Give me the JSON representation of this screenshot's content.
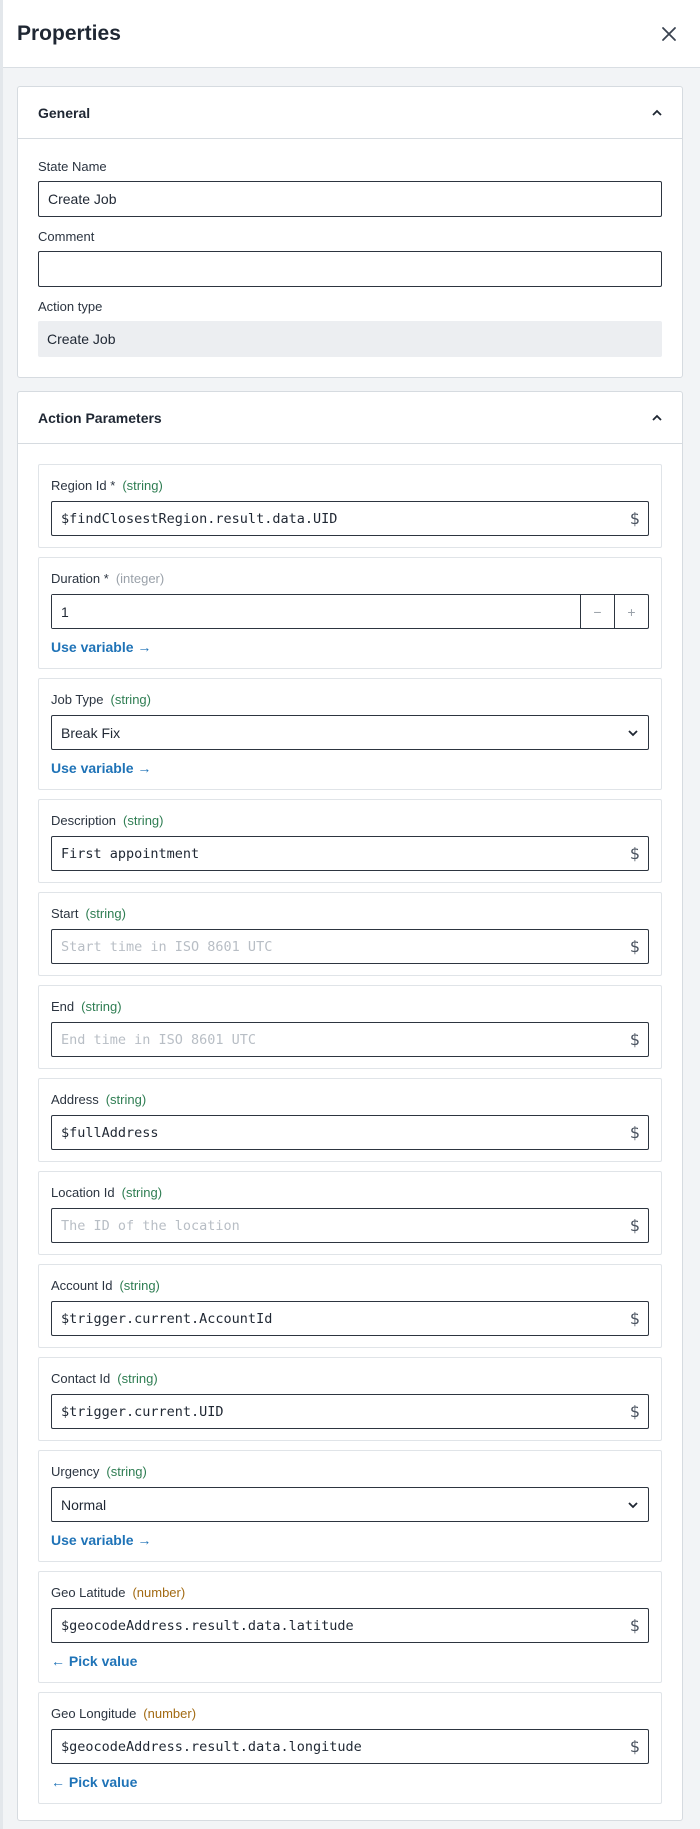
{
  "header": {
    "title": "Properties",
    "close_icon": "close-icon"
  },
  "general": {
    "title": "General",
    "state_name": {
      "label": "State Name",
      "value": "Create Job"
    },
    "comment": {
      "label": "Comment",
      "value": ""
    },
    "action_type": {
      "label": "Action type",
      "value": "Create Job"
    }
  },
  "params": {
    "title": "Action Parameters",
    "region_id": {
      "label": "Region Id *",
      "type": "(string)",
      "value": "$findClosestRegion.result.data.UID",
      "placeholder": ""
    },
    "duration": {
      "label": "Duration *",
      "type": "(integer)",
      "value": "1",
      "minus": "−",
      "plus": "+",
      "link": "Use variable →"
    },
    "job_type": {
      "label": "Job Type",
      "type": "(string)",
      "value": "Break Fix",
      "link": "Use variable →"
    },
    "description": {
      "label": "Description",
      "type": "(string)",
      "value": "First appointment",
      "placeholder": ""
    },
    "start": {
      "label": "Start",
      "type": "(string)",
      "value": "",
      "placeholder": "Start time in ISO 8601 UTC"
    },
    "end": {
      "label": "End",
      "type": "(string)",
      "value": "",
      "placeholder": "End time in ISO 8601 UTC"
    },
    "address": {
      "label": "Address",
      "type": "(string)",
      "value": "$fullAddress",
      "placeholder": ""
    },
    "location_id": {
      "label": "Location Id",
      "type": "(string)",
      "value": "",
      "placeholder": "The ID of the location"
    },
    "account_id": {
      "label": "Account Id",
      "type": "(string)",
      "value": "$trigger.current.AccountId",
      "placeholder": ""
    },
    "contact_id": {
      "label": "Contact Id",
      "type": "(string)",
      "value": "$trigger.current.UID",
      "placeholder": ""
    },
    "urgency": {
      "label": "Urgency",
      "type": "(string)",
      "value": "Normal",
      "link": "Use variable →"
    },
    "geo_latitude": {
      "label": "Geo Latitude",
      "type": "(number)",
      "value": "$geocodeAddress.result.data.latitude",
      "placeholder": "",
      "link": "← Pick value"
    },
    "geo_longitude": {
      "label": "Geo Longitude",
      "type": "(number)",
      "value": "$geocodeAddress.result.data.longitude",
      "placeholder": "",
      "link": "← Pick value"
    }
  },
  "dollar": "$",
  "colors": {
    "link": "#1f73b7",
    "string_type": "#2e7d52",
    "number_type": "#a26a12",
    "integer_type": "#9aa1a9"
  }
}
